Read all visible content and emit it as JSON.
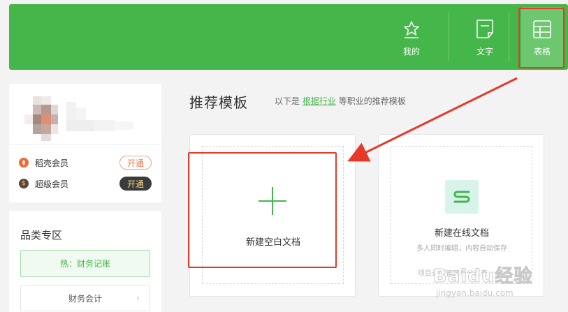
{
  "header": {
    "tabs": [
      {
        "label": "我的",
        "icon": "star-doc-icon"
      },
      {
        "label": "文字",
        "icon": "text-doc-icon"
      },
      {
        "label": "表格",
        "icon": "table-icon",
        "active": true
      }
    ]
  },
  "profile": {
    "members": [
      {
        "name": "稻壳会员",
        "action": "开通",
        "color": "#f26a2e"
      },
      {
        "name": "超级会员",
        "action": "开通",
        "color": "#3b3b3b"
      }
    ]
  },
  "category": {
    "title": "品类专区",
    "hot": "热：财务记账",
    "item": "财务会计"
  },
  "main": {
    "title": "推荐模板",
    "subtitle_prefix": "以下是",
    "subtitle_link": "根据行业",
    "subtitle_suffix": "等职业的推荐模板",
    "blank_card": {
      "label": "新建空白文档"
    },
    "online_card": {
      "icon_letter": "S",
      "label": "新建在线文档",
      "desc": "多人同时编辑，内容自动保存",
      "desc2": "项目进度管理与分工表"
    }
  },
  "watermark": {
    "main": "Baidu经验",
    "url": "jingyan.baidu.com"
  },
  "colors": {
    "brand_green": "#45b649",
    "highlight_red": "#e53a2a"
  }
}
